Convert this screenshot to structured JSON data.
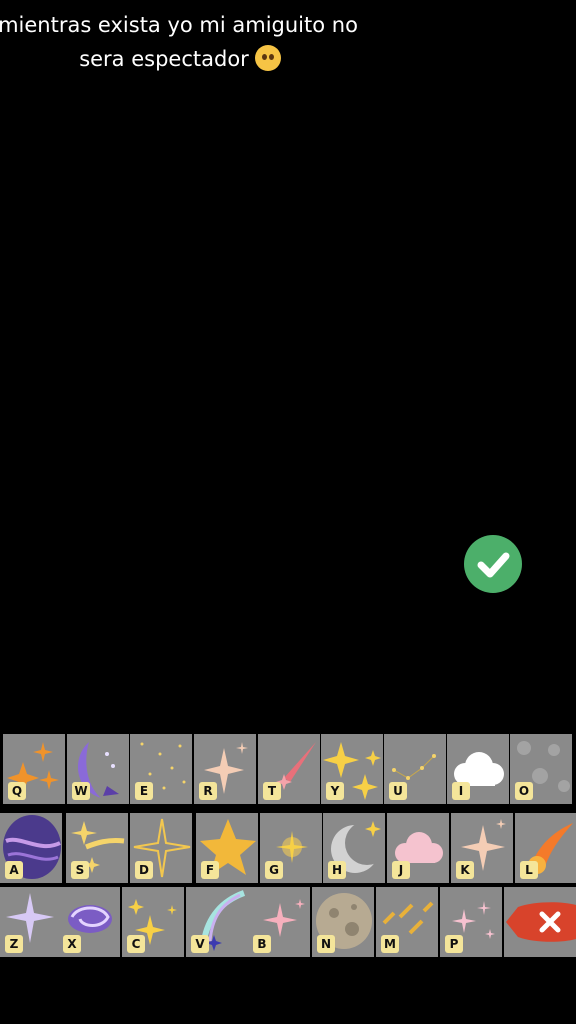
{
  "caption": {
    "line1": "mientras exista yo mi amiguito no",
    "line2": "sera espectador"
  },
  "confirm_icon": "check-icon",
  "colors": {
    "confirm": "#4caf6a",
    "key_bg": "#8a8a8a",
    "letter_badge": "#f4e59a",
    "delete": "#d8432b"
  },
  "keyboard": {
    "row1": [
      {
        "letter": "Q",
        "icon": "orange-sparkles-icon"
      },
      {
        "letter": "W",
        "icon": "purple-moon-icon"
      },
      {
        "letter": "E",
        "icon": "tiny-stars-icon"
      },
      {
        "letter": "R",
        "icon": "peach-sparkle-icon"
      },
      {
        "letter": "T",
        "icon": "pink-shooting-star-icon"
      },
      {
        "letter": "Y",
        "icon": "yellow-sparkles-icon"
      },
      {
        "letter": "U",
        "icon": "constellation-icon"
      },
      {
        "letter": "I",
        "icon": "cloud-icon"
      },
      {
        "letter": "O",
        "icon": "asteroids-icon"
      }
    ],
    "row2": [
      {
        "letter": "A",
        "icon": "galaxy-planet-icon"
      },
      {
        "letter": "S",
        "icon": "shooting-stars-icon"
      },
      {
        "letter": "D",
        "icon": "gold-outline-star-icon"
      },
      {
        "letter": "F",
        "icon": "gold-star-icon"
      },
      {
        "letter": "G",
        "icon": "glow-star-icon"
      },
      {
        "letter": "H",
        "icon": "crescent-moon-icon"
      },
      {
        "letter": "J",
        "icon": "pink-cloud-icon"
      },
      {
        "letter": "K",
        "icon": "peach-sparkles-icon"
      },
      {
        "letter": "L",
        "icon": "comet-icon"
      }
    ],
    "row3": [
      {
        "letter": "Z",
        "icon": "violet-sparkle-icon"
      },
      {
        "letter": "X",
        "icon": "spiral-galaxy-icon"
      },
      {
        "letter": "C",
        "icon": "gold-sparkles-icon"
      },
      {
        "letter": "V",
        "icon": "rainbow-comet-icon"
      },
      {
        "letter": "B",
        "icon": "pink-sparkle-icon"
      },
      {
        "letter": "N",
        "icon": "moon-surface-icon"
      },
      {
        "letter": "M",
        "icon": "meteor-shower-icon"
      },
      {
        "letter": "P",
        "icon": "pink-twinkles-icon"
      }
    ],
    "delete_icon": "delete-x-icon"
  }
}
